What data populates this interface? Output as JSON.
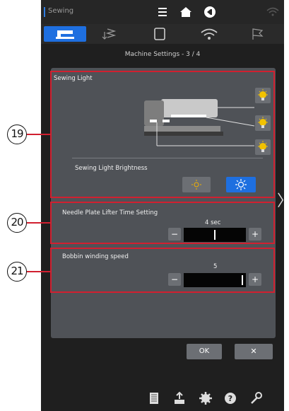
{
  "header": {
    "app_title": "Sewing"
  },
  "page": {
    "title": "Machine Settings - 3 / 4"
  },
  "light_section": {
    "label": "Sewing Light",
    "brightness_label": "Sewing Light Brightness"
  },
  "needle_section": {
    "label": "Needle Plate Lifter Time Setting",
    "value": "4 sec",
    "minus": "−",
    "plus": "+",
    "level": 0.5
  },
  "bobbin_section": {
    "label": "Bobbin winding speed",
    "value": "5",
    "minus": "−",
    "plus": "+",
    "level": 0.97
  },
  "footer": {
    "ok_label": "OK",
    "cancel_label": "✕"
  },
  "callouts": {
    "a": "19",
    "b": "20",
    "c": "21"
  },
  "colors": {
    "accent": "#1e6fe0",
    "frame": "#d12030"
  }
}
